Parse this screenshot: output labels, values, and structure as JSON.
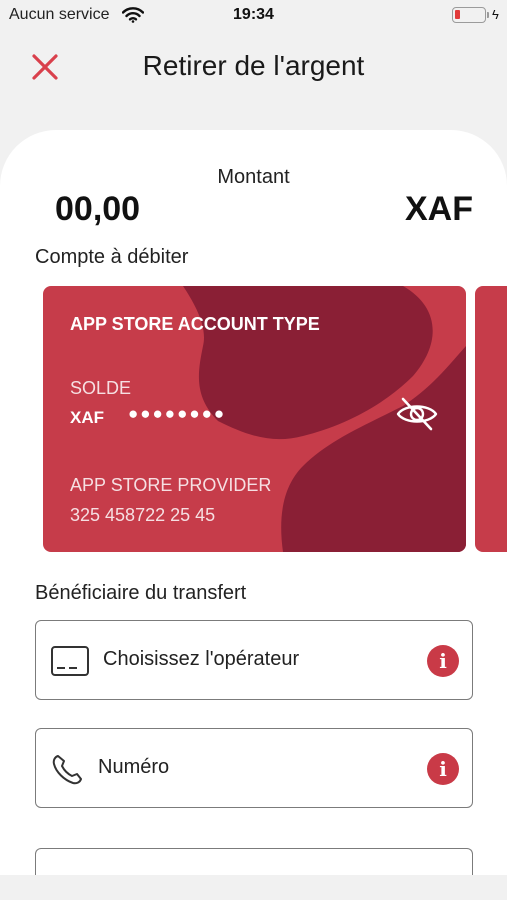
{
  "status_bar": {
    "carrier": "Aucun service",
    "time": "19:34",
    "wifi_icon": "wifi-icon",
    "battery_icon": "battery-low-icon",
    "battery_color": "#e23b3b"
  },
  "header": {
    "title": "Retirer de l'argent",
    "close_icon": "close-icon",
    "accent_color": "#d9404c"
  },
  "amount": {
    "label": "Montant",
    "value": "00,00",
    "currency": "XAF"
  },
  "debit_section": {
    "label": "Compte à débiter"
  },
  "account_card": {
    "type": "APP STORE ACCOUNT TYPE",
    "balance_label": "SOLDE",
    "currency": "XAF",
    "balance_mask": "●●●●●●●●",
    "visibility_icon": "eye-off-icon",
    "provider": "APP STORE PROVIDER",
    "number": "325 458722 25 45",
    "card_color": "#c63c4a",
    "shape_color": "#8a1f35"
  },
  "beneficiary_section": {
    "label": "Bénéficiaire du transfert",
    "operator_field": {
      "label": "Choisissez l'opérateur",
      "icon": "card-icon",
      "info_icon": "info-icon"
    },
    "number_field": {
      "label": "Numéro",
      "icon": "phone-icon",
      "info_icon": "info-icon"
    }
  }
}
